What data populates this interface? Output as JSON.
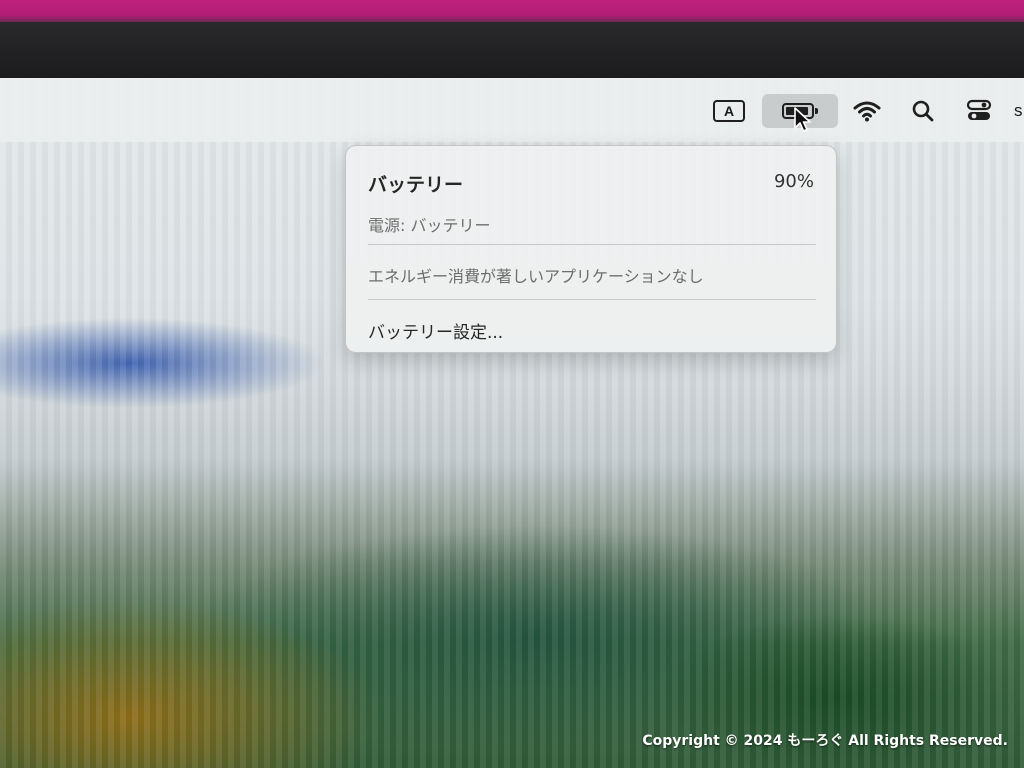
{
  "menubar": {
    "input_source_label": "A",
    "battery_icon": "battery-icon",
    "wifi_icon": "wifi-icon",
    "search_icon": "search-icon",
    "control_center_icon": "control-center-icon",
    "clock_partial": "s"
  },
  "battery_menu": {
    "title": "バッテリー",
    "percent": "90%",
    "level": 0.9,
    "power_source": "電源: バッテリー",
    "energy_status": "エネルギー消費が著しいアプリケーションなし",
    "settings_item": "バッテリー設定..."
  },
  "watermark": {
    "text": "Copyright © 2024 もーろぐ All Rights Reserved."
  }
}
